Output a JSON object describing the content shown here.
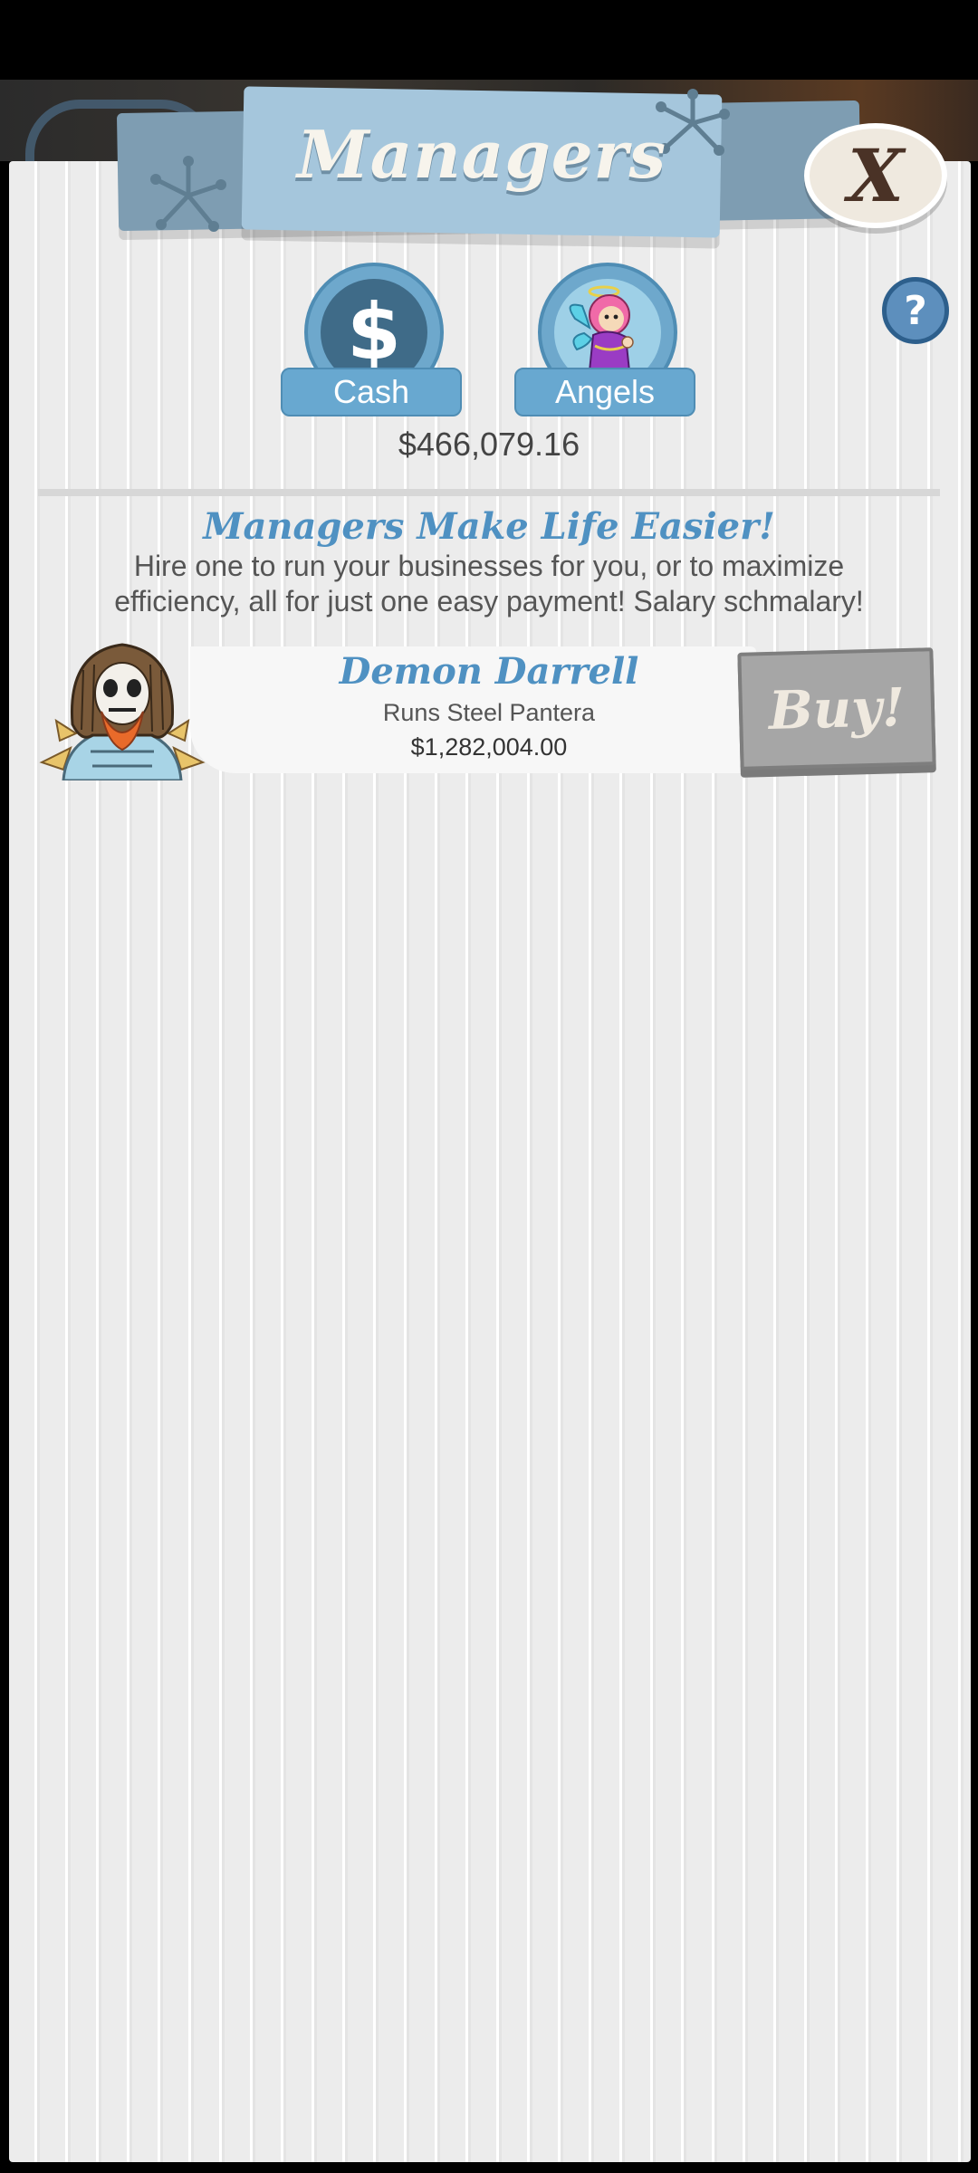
{
  "header": {
    "title": "Managers",
    "close_label": "X"
  },
  "currency_tabs": [
    {
      "label": "Cash",
      "icon": "dollar-icon",
      "symbol": "$"
    },
    {
      "label": "Angels",
      "icon": "angel-icon"
    }
  ],
  "help": {
    "label": "?"
  },
  "balance": "$466,079.16",
  "intro": {
    "heading": "Managers Make Life Easier!",
    "description": "Hire one to run your businesses for you, or to maximize efficiency, all for just one easy payment! Salary schmalary!"
  },
  "managers": [
    {
      "name": "Demon Darrell",
      "runs": "Runs Steel Pantera",
      "price": "$1,282,004.00",
      "buy_label": "Buy!",
      "avatar_icon": "demon-manager-avatar"
    }
  ],
  "colors": {
    "accent_blue": "#4f91c2",
    "banner_blue": "#a5c6dc",
    "buy_disabled_gray": "#a6a6a6",
    "close_brown": "#4a3226"
  }
}
